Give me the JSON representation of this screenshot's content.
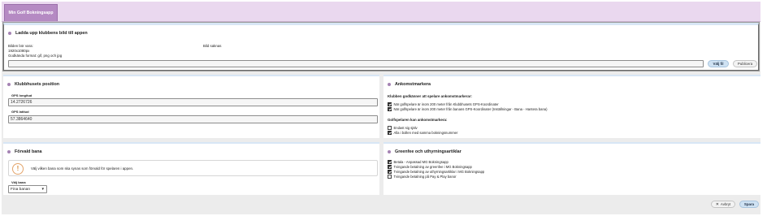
{
  "app": {
    "tab_label": "Min Golf Bokningsapp"
  },
  "upload": {
    "title": "Ladda upp klubbens bild till appen",
    "image_label": "Bilden bör vara:",
    "size": "1920x1080px",
    "formats": "Godkända format: gif, png och jpg",
    "missing": "Bild saknas",
    "choose_label": "Välj fil",
    "publish_label": "Publicera"
  },
  "position": {
    "title": "Klubbhusets position",
    "lon_label": "GPS longitud",
    "lon_value": "14.2726726",
    "lat_label": "GPS latitud",
    "lat_value": "57.3864640"
  },
  "arrival": {
    "title": "Ankomstmarkera",
    "intro": "Klubben godkänner att spelare ankomstmarkerar:",
    "options": [
      {
        "label": "När golfspelare är inom 200 meter från Klubbhusets GPS-Koordinater",
        "checked": true
      },
      {
        "label": "När golfspelare är inom 200 meter från banans GPS-Koordinater (Inställningar - Bana - Hantera bana)",
        "checked": true
      }
    ],
    "golfer_intro": "Golfspelaren kan ankomstmarkera:",
    "golfer_options": [
      {
        "label": "Endast sig själv",
        "checked": false
      },
      {
        "label": "Alla i bollen med samma bokningsnummer",
        "checked": true
      }
    ]
  },
  "course": {
    "title": "Förvald bana",
    "info": "Välj vilken bana som ska synas som förvald för spelaren i appen.",
    "select_label": "Välj bana",
    "select_value": "Fina banan"
  },
  "greenfee": {
    "title": "Greenfee och uthyrningsartiklar",
    "options": [
      {
        "label": "Betala - Anpassad MG Bokningsapp",
        "checked": true
      },
      {
        "label": "Tvingande betalning av greenfee i MG Bokningsapp",
        "checked": true
      },
      {
        "label": "Tvingande betalning av uthyrningsartiklar i MG Bokningsapp",
        "checked": true
      },
      {
        "label": "Tvingande betalning på Pay & Play banor",
        "checked": false
      }
    ]
  },
  "footer": {
    "cancel_label": "Avbryt",
    "save_label": "Spara"
  },
  "colors": {
    "accent": "#a583b4",
    "tab": "#b58ac3",
    "button": "#cfe2f3"
  }
}
